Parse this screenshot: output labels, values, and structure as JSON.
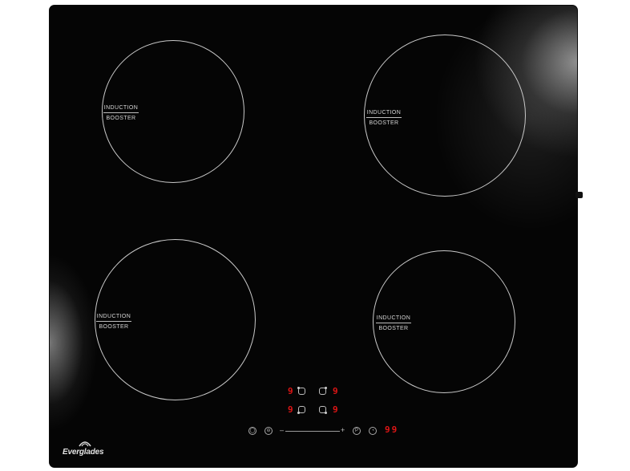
{
  "brand": "Everglades",
  "zones": [
    {
      "id": "front-left",
      "line1": "INDUCTION",
      "line2": "BOOSTER"
    },
    {
      "id": "rear-left",
      "line1": "INDUCTION",
      "line2": "BOOSTER"
    },
    {
      "id": "rear-right",
      "line1": "INDUCTION",
      "line2": "BOOSTER"
    },
    {
      "id": "front-right",
      "line1": "INDUCTION",
      "line2": "BOOSTER"
    }
  ],
  "controls": {
    "zone_levels": [
      "9",
      "9",
      "9",
      "9"
    ],
    "timer_display": "99",
    "minus": "–",
    "plus": "+",
    "pause_symbol": "P",
    "colors": {
      "display": "#e01515",
      "glass": "#050505",
      "print": "#c9c9c9"
    }
  }
}
